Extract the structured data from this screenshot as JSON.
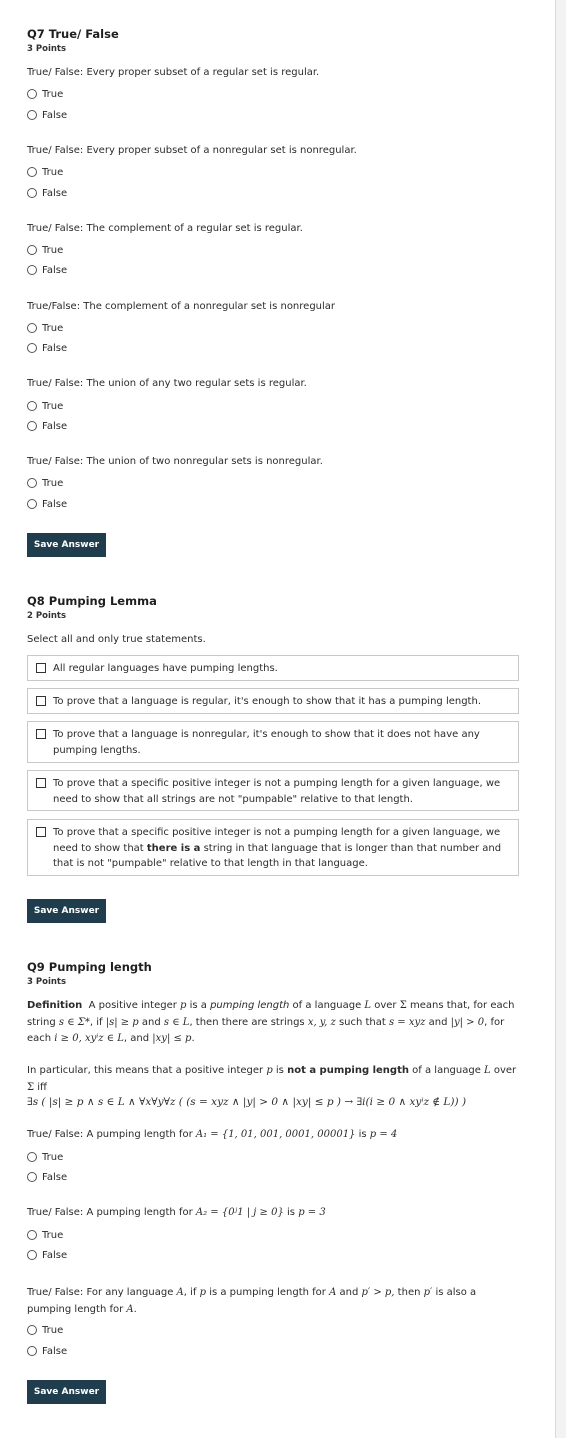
{
  "q7": {
    "title": "Q7 True/ False",
    "points": "3 Points",
    "items": [
      {
        "prompt": "True/ False: Every proper subset of a regular set is regular."
      },
      {
        "prompt": "True/ False: Every proper subset of a nonregular set is nonregular."
      },
      {
        "prompt": "True/ False: The complement of a regular set is regular."
      },
      {
        "prompt": "True/False: The complement of a nonregular set is nonregular"
      },
      {
        "prompt": "True/ False: The union of any two regular sets is regular."
      },
      {
        "prompt": "True/ False: The union of two nonregular sets is nonregular."
      }
    ],
    "true_label": "True",
    "false_label": "False",
    "save_label": "Save Answer"
  },
  "q8": {
    "title": "Q8 Pumping Lemma",
    "points": "2 Points",
    "instruction": "Select all and only true statements.",
    "options": [
      "All regular languages have pumping lengths.",
      "To prove that a language is regular, it's enough to show that it has a pumping length.",
      "To prove that a language is nonregular, it's enough to show that it does not have any pumping lengths.",
      "To prove that a specific positive integer is not a pumping length for a given language, we need to show that all strings are not \"pumpable\" relative to that length."
    ],
    "option5": {
      "part1": "To prove that a specific positive integer is not a pumping length for a given language, we need to show that ",
      "bold": "there is a",
      "part2": " string in that language that is longer than that number and that is not \"pumpable\" relative to that length in that language."
    },
    "save_label": "Save Answer"
  },
  "q9": {
    "title": "Q9 Pumping length",
    "points": "3 Points",
    "def_label": "Definition",
    "def_a": "A positive integer ",
    "def_p": "p",
    "def_b": " is a ",
    "def_em": "pumping length",
    "def_c": " of a language ",
    "def_L": "L",
    "def_d": " over ",
    "def_Sigma": "Σ",
    "def_e": " means that, for each string ",
    "def_m1": "s ∈ Σ*",
    "def_f": ", if ",
    "def_m2": "|s| ≥ p",
    "def_g": " and ",
    "def_m3": "s ∈ L",
    "def_h": ", then there are strings ",
    "def_m4": "x, y, z",
    "def_i": " such that ",
    "def_m5": "s = xyz",
    "def_j": " and ",
    "def_m6": "|y| > 0",
    "def_k": ", for each ",
    "def_m7": "i ≥ 0, xyⁱz ∈ L",
    "def_l": ", and ",
    "def_m8": "|xy| ≤ p",
    "def_end": ".",
    "part_a": "In particular, this means that a positive integer ",
    "part_p": "p",
    "part_b": " is ",
    "part_bold": "not a pumping length",
    "part_c": " of a language ",
    "part_L": "L",
    "part_d": " over",
    "part_Sigma": "Σ",
    "part_iff": " iff",
    "formula": "∃s ( |s| ≥ p ∧ s ∈ L ∧ ∀x∀y∀z ( (s = xyz ∧ |y| > 0 ∧ |xy| ≤ p ) → ∃i(i ≥ 0 ∧ xyⁱz ∉ L)) )",
    "item1_a": "True/ False: A pumping length for ",
    "item1_m": "A₁ = {1, 01, 001, 0001, 00001}",
    "item1_b": " is ",
    "item1_m2": "p = 4",
    "item2_a": "True/ False: A pumping length for ",
    "item2_m": "A₂ = {0ʲ1 | j ≥ 0}",
    "item2_b": " is ",
    "item2_m2": "p = 3",
    "item3_a": "True/ False: For any language ",
    "item3_A": "A",
    "item3_b": ", if ",
    "item3_p": "p",
    "item3_c": " is a  pumping length for ",
    "item3_A2": "A",
    "item3_d": " and ",
    "item3_m": "p′ > p,",
    "item3_e": "  then ",
    "item3_p2": "p′",
    "item3_f": " is also a pumping length for ",
    "item3_A3": "A",
    "item3_g": ".",
    "true_label": "True",
    "false_label": "False",
    "save_label": "Save Answer"
  }
}
